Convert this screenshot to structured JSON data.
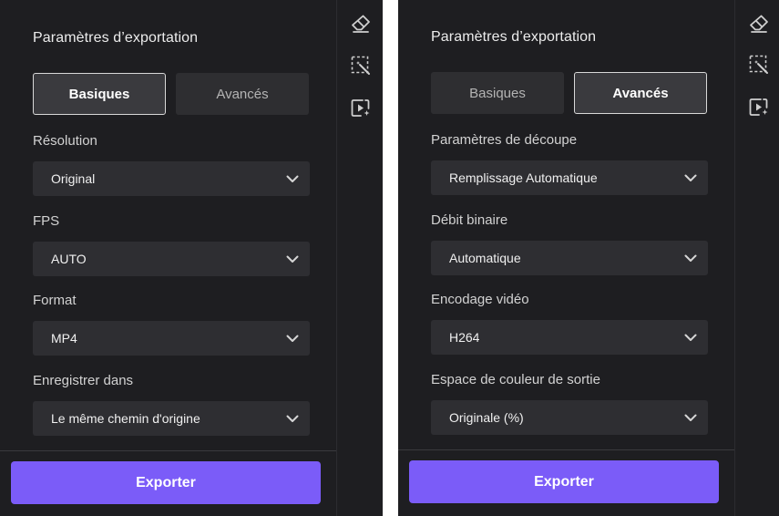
{
  "panels": [
    {
      "title": "Paramètres d’exportation",
      "tabs": [
        {
          "label": "Basiques",
          "active": true
        },
        {
          "label": "Avancés",
          "active": false
        }
      ],
      "fields": [
        {
          "label": "Résolution",
          "value": "Original"
        },
        {
          "label": "FPS",
          "value": "AUTO"
        },
        {
          "label": "Format",
          "value": "MP4"
        },
        {
          "label": "Enregistrer dans",
          "value": "Le même chemin d'origine"
        }
      ],
      "export_label": "Exporter"
    },
    {
      "title": "Paramètres d’exportation",
      "tabs": [
        {
          "label": "Basiques",
          "active": false
        },
        {
          "label": "Avancés",
          "active": true
        }
      ],
      "fields": [
        {
          "label": "Paramètres de découpe",
          "value": "Remplissage Automatique"
        },
        {
          "label": "Débit binaire",
          "value": "Automatique"
        },
        {
          "label": "Encodage vidéo",
          "value": "H264"
        },
        {
          "label": "Espace de couleur de sortie",
          "value": "Originale (%)"
        }
      ],
      "export_label": "Exporter"
    }
  ],
  "toolbar_icons": [
    "eraser-icon",
    "magic-select-icon",
    "video-sparkle-icon"
  ],
  "colors": {
    "background": "#1e1e21",
    "select_bg": "#2e2e32",
    "accent": "#7b5cf8",
    "text": "#ececec"
  }
}
